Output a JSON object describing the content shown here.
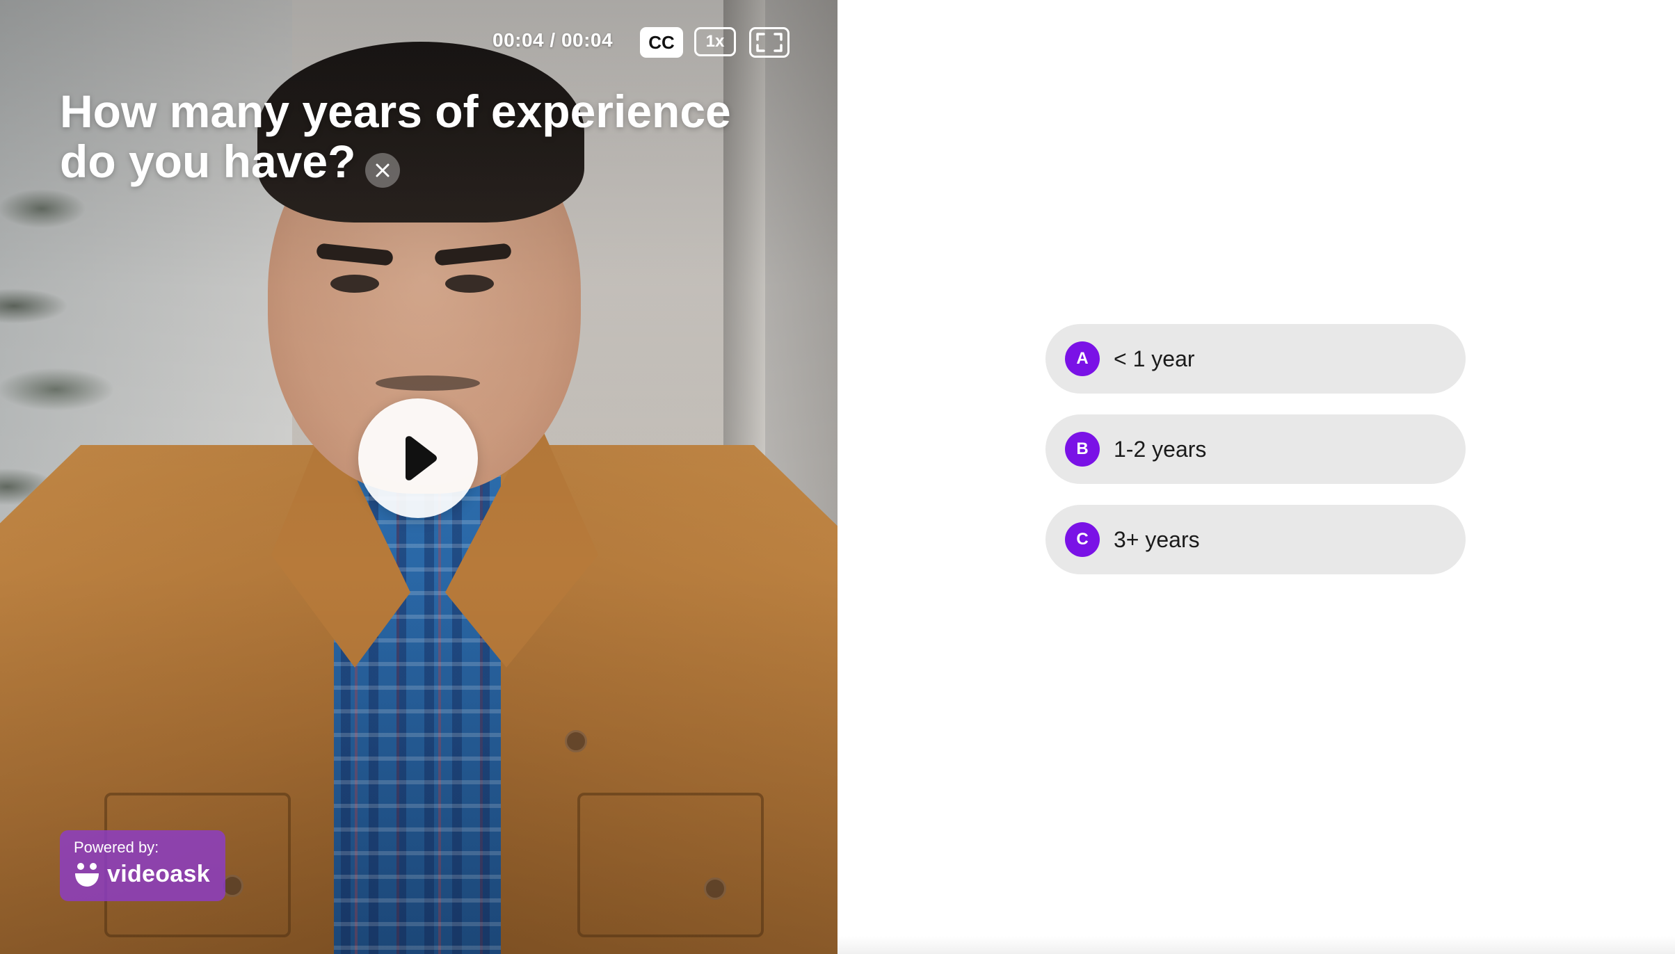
{
  "video": {
    "time": "00:04 / 00:04",
    "cc_label": "CC",
    "speed_label": "1x"
  },
  "question": {
    "title": "How many years of experience do you have?"
  },
  "icons": {
    "close": "close-icon",
    "play": "play-icon",
    "fullscreen": "fullscreen-icon",
    "brand_logo": "videoask-smile-icon"
  },
  "branding": {
    "powered_by": "Powered by:",
    "name": "videoask",
    "color": "#8c3cc8"
  },
  "options": [
    {
      "letter": "A",
      "label": "< 1 year"
    },
    {
      "letter": "B",
      "label": "1-2 years"
    },
    {
      "letter": "C",
      "label": "3+ years"
    }
  ],
  "colors": {
    "accent": "#7a12e6",
    "option_bg": "#e8e8e8"
  }
}
